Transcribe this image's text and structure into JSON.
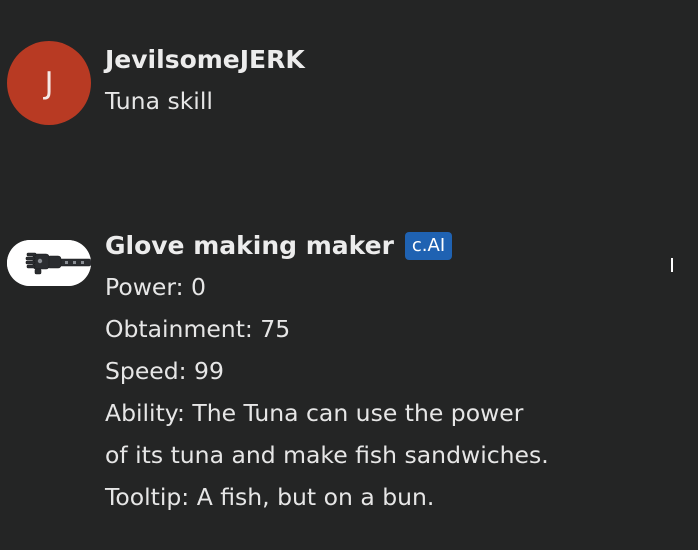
{
  "messages": {
    "user": {
      "avatar_initial": "J",
      "avatar_color": "#b83a23",
      "author": "JevilsomeJERK",
      "text": "Tuna skill"
    },
    "bot": {
      "avatar_icon": "robotic-glove-image",
      "author": "Glove making maker",
      "badge": "c.AI",
      "badge_color": "#1f62b2",
      "lines": [
        "Power: 0",
        "Obtainment: 75",
        "Speed: 99",
        "Ability: The Tuna can use the power",
        "of its tuna and make fish sandwiches.",
        "Tooltip: A fish, but on a bun."
      ]
    }
  }
}
